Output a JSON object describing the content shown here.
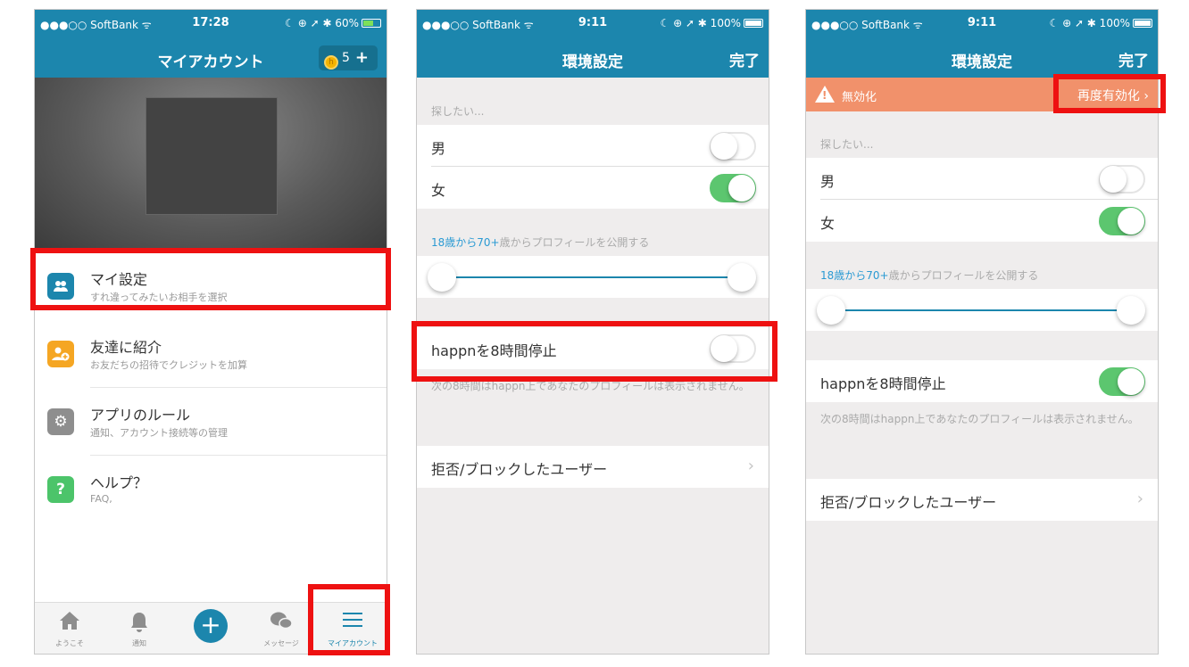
{
  "colors": {
    "brand": "#1c86ad",
    "toggle_on": "#5cc66f",
    "warning": "#f1916b",
    "highlight": "#ee1111"
  },
  "screen1": {
    "status": {
      "carrier": "●●●○○ SoftBank ᯤ",
      "time": "17:28",
      "right": "☾ ⊕ ➚ ✱ 60%"
    },
    "title": "マイアカウント",
    "credits": "5",
    "credit_plus": "+",
    "menu": [
      {
        "title": "マイ設定",
        "sub": "すれ違ってみたいお相手を選択",
        "icon": "users-icon",
        "color": "#1c86ad",
        "glyph": "👥"
      },
      {
        "title": "友達に紹介",
        "sub": "お友だちの招待でクレジットを加算",
        "icon": "add-friend-icon",
        "color": "#f5a623",
        "glyph": "+"
      },
      {
        "title": "アプリのルール",
        "sub": "通知、アカウント接続等の管理",
        "icon": "gear-icon",
        "color": "#8e8e8e",
        "glyph": "⚙"
      },
      {
        "title": "ヘルプ？",
        "sub": "FAQ,",
        "icon": "help-icon",
        "color": "#4cc46a",
        "glyph": "?"
      }
    ],
    "tabs": [
      {
        "label": "ようこそ",
        "glyph": "⌂"
      },
      {
        "label": "通知",
        "glyph": "🔔"
      },
      {
        "label": "",
        "glyph": "+"
      },
      {
        "label": "メッセージ",
        "glyph": "💬"
      },
      {
        "label": "マイアカウント",
        "glyph": "☰"
      }
    ]
  },
  "screen2": {
    "status": {
      "carrier": "●●●○○ SoftBank ᯤ",
      "time": "9:11",
      "right": "☾ ⊕ ➚ ✱ 100%"
    },
    "title": "環境設定",
    "done": "完了",
    "seeking_label": "探したい...",
    "male": "男",
    "female": "女",
    "male_on": false,
    "female_on": true,
    "age_from": "18歳から70+",
    "age_suffix": "歳からプロフィールを公開する",
    "pause_label": "happnを8時間停止",
    "pause_on": false,
    "pause_note": "次の8時間はhappn上であなたのプロフィールは表示されません。",
    "blocked": "拒否/ブロックしたユーザー"
  },
  "screen3": {
    "status": {
      "carrier": "●●●○○ SoftBank ᯤ",
      "time": "9:11",
      "right": "☾ ⊕ ➚ ✱ 100%"
    },
    "title": "環境設定",
    "done": "完了",
    "warning_text": "無効化",
    "reactivate": "再度有効化 ›",
    "seeking_label": "探したい...",
    "male": "男",
    "female": "女",
    "male_on": false,
    "female_on": true,
    "age_from": "18歳から70+",
    "age_suffix": "歳からプロフィールを公開する",
    "pause_label": "happnを8時間停止",
    "pause_on": true,
    "pause_note": "次の8時間はhappn上であなたのプロフィールは表示されません。",
    "blocked": "拒否/ブロックしたユーザー"
  }
}
